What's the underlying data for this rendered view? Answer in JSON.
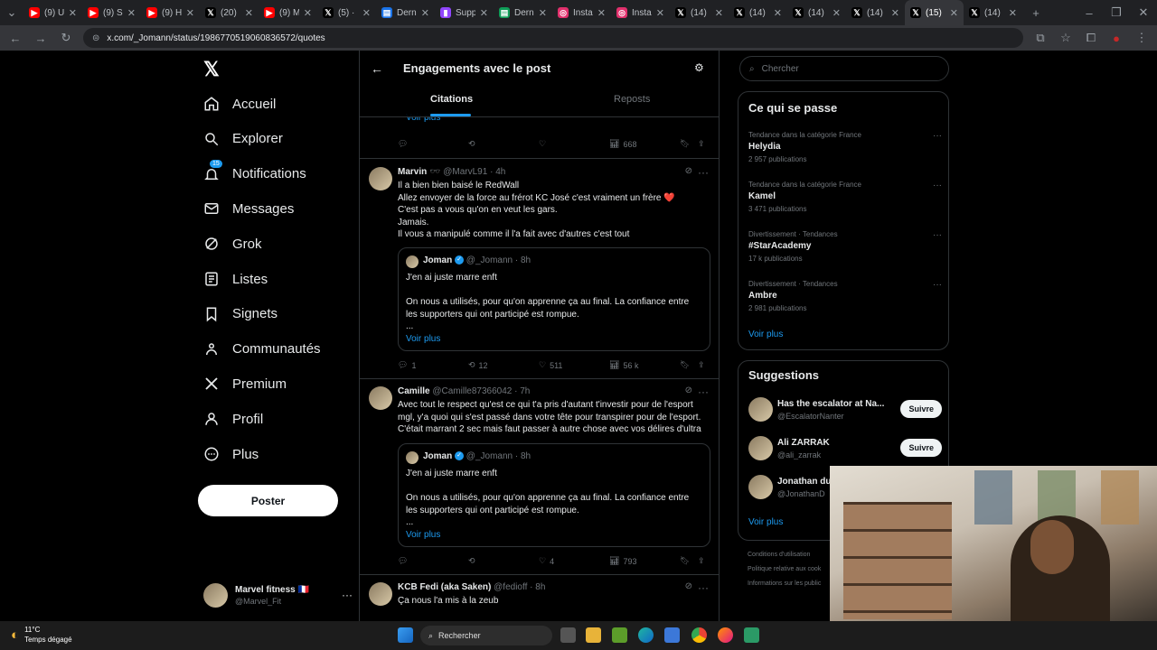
{
  "browser": {
    "tabs": [
      {
        "label": "(9) U",
        "icon": "youtube",
        "color": "#ff0000"
      },
      {
        "label": "(9) S",
        "icon": "youtube",
        "color": "#ff0000"
      },
      {
        "label": "(9) H",
        "icon": "youtube",
        "color": "#ff0000"
      },
      {
        "label": "(20)",
        "icon": "x",
        "color": "#000000"
      },
      {
        "label": "(9) M",
        "icon": "youtube",
        "color": "#ff0000"
      },
      {
        "label": "(5) ·",
        "icon": "x",
        "color": "#000000"
      },
      {
        "label": "Derni",
        "icon": "sheet",
        "color": "#1a73e8"
      },
      {
        "label": "Supp",
        "icon": "twitch",
        "color": "#9146ff"
      },
      {
        "label": "Derni",
        "icon": "sheet",
        "color": "#0f9d58"
      },
      {
        "label": "Insta",
        "icon": "instagram",
        "color": "#e1306c"
      },
      {
        "label": "Insta",
        "icon": "instagram",
        "color": "#e1306c"
      },
      {
        "label": "(14)",
        "icon": "x",
        "color": "#000000"
      },
      {
        "label": "(14)",
        "icon": "x",
        "color": "#000000"
      },
      {
        "label": "(14)",
        "icon": "x",
        "color": "#000000"
      },
      {
        "label": "(14)",
        "icon": "x",
        "color": "#000000"
      },
      {
        "label": "(15)",
        "icon": "x",
        "color": "#000000",
        "active": true
      },
      {
        "label": "(14)",
        "icon": "x",
        "color": "#000000"
      }
    ],
    "url": "x.com/_Jomann/status/1986770519060836572/quotes"
  },
  "nav": {
    "items": [
      {
        "label": "Accueil",
        "icon": "home-icon"
      },
      {
        "label": "Explorer",
        "icon": "search-icon"
      },
      {
        "label": "Notifications",
        "icon": "bell-icon",
        "badge": "15"
      },
      {
        "label": "Messages",
        "icon": "mail-icon"
      },
      {
        "label": "Grok",
        "icon": "grok-icon"
      },
      {
        "label": "Listes",
        "icon": "list-icon"
      },
      {
        "label": "Signets",
        "icon": "bookmark-icon"
      },
      {
        "label": "Communautés",
        "icon": "community-icon"
      },
      {
        "label": "Premium",
        "icon": "x-logo-icon"
      },
      {
        "label": "Profil",
        "icon": "person-icon"
      },
      {
        "label": "Plus",
        "icon": "more-icon"
      }
    ],
    "post_label": "Poster",
    "account": {
      "name": "Marvel fitness 🇫🇷",
      "handle": "@Marvel_Fit"
    }
  },
  "main": {
    "title": "Engagements avec le post",
    "tabs": [
      "Citations",
      "Reposts"
    ],
    "top_fragment": {
      "voir_plus": "Voir plus",
      "views": "668"
    },
    "tweets": [
      {
        "name": "Marvin 🕶️",
        "handle": "@MarvL91",
        "time": "· 4h",
        "lines": [
          "Il a bien bien baisé le RedWall",
          "Allez envoyer de la force au frérot KC José c'est vraiment un frère ❤️",
          "C'est pas a vous qu'on en veut les gars.",
          "Jamais.",
          "Il vous a manipulé comme il l'a fait avec d'autres c'est tout"
        ],
        "quote": {
          "name": "Joman",
          "handle": "@_Jomann",
          "time": "· 8h",
          "lines": [
            "J'en ai juste marre enft",
            "",
            "On nous a utilisés, pour qu'on apprenne ça au final. La confiance entre",
            "les supporters qui ont participé est rompue.",
            "..."
          ],
          "more": "Voir plus"
        },
        "stats": {
          "replies": "1",
          "reposts": "12",
          "likes": "511",
          "views": "56 k"
        }
      },
      {
        "name": "Camille",
        "handle": "@Camille87366042",
        "time": "· 7h",
        "lines": [
          "Avec tout le respect qu'est ce qui t'a pris d'autant t'investir  pour de l'esport",
          "mgl, y'a quoi qui s'est passé dans votre tête pour transpirer pour de l'esport.",
          "C'était marrant 2 sec mais faut passer à autre chose avec vos délires d'ultra"
        ],
        "quote": {
          "name": "Joman",
          "handle": "@_Jomann",
          "time": "· 8h",
          "lines": [
            "J'en ai juste marre enft",
            "",
            "On nous a utilisés, pour qu'on apprenne ça au final. La confiance entre",
            "les supporters qui ont participé est rompue.",
            "..."
          ],
          "more": "Voir plus"
        },
        "stats": {
          "replies": "",
          "reposts": "",
          "likes": "4",
          "views": "793"
        }
      },
      {
        "name": "KCB Fedi (aka Saken)",
        "handle": "@fedioff",
        "time": "· 8h",
        "lines": [
          "Ça nous l'a mis à la zeub"
        ]
      }
    ]
  },
  "right": {
    "search_placeholder": "Chercher",
    "trends_title": "Ce qui se passe",
    "trends": [
      {
        "cat": "Tendance dans la catégorie France",
        "name": "Helydia",
        "count": "2 957 publications"
      },
      {
        "cat": "Tendance dans la catégorie France",
        "name": "Kamel",
        "count": "3 471 publications"
      },
      {
        "cat": "Divertissement · Tendances",
        "name": "#StarAcademy",
        "count": "17 k publications"
      },
      {
        "cat": "Divertissement · Tendances",
        "name": "Ambre",
        "count": "2 981 publications"
      }
    ],
    "trends_more": "Voir plus",
    "sugg_title": "Suggestions",
    "suggestions": [
      {
        "name": "Has the escalator at Na...",
        "handle": "@EscalatorNanter",
        "button": "Suivre"
      },
      {
        "name": "Ali ZARRAK",
        "handle": "@ali_zarrak",
        "button": "Suivre"
      },
      {
        "name": "Jonathan du",
        "handle": "@JonathanD",
        "button": ""
      }
    ],
    "sugg_more": "Voir plus",
    "legal": [
      "Conditions d'utilisation",
      "Politique relative aux cook",
      "Informations sur les public"
    ]
  },
  "taskbar": {
    "temp": "11°C",
    "weather": "Temps dégagé",
    "search": "Rechercher"
  }
}
